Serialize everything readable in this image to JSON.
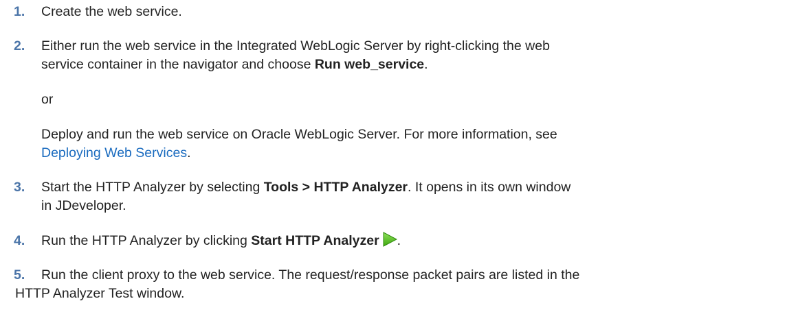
{
  "steps": [
    {
      "number": "1.",
      "text": "Create the web service."
    },
    {
      "number": "2.",
      "line1": "Either run the web service in the Integrated WebLogic Server by right-clicking the web",
      "line2_pre": "service container in the navigator and choose ",
      "line2_bold": "Run web_service",
      "line2_post": "."
    },
    {
      "number": "3.",
      "line1_pre": "Start the HTTP Analyzer by selecting ",
      "line1_bold": "Tools > HTTP Analyzer",
      "line1_post": ". It opens in its own window",
      "line2": "in JDeveloper."
    },
    {
      "number": "4.",
      "pre": "Run the HTTP Analyzer by clicking ",
      "bold": "Start HTTP Analyzer",
      "post": "."
    },
    {
      "number": "5.",
      "line1": "Run the client proxy to the web service. The request/response packet pairs are listed in the",
      "line2": "HTTP Analyzer Test window."
    }
  ],
  "or_text": "or",
  "deploy": {
    "line1": "Deploy and run the web service on Oracle WebLogic Server. For more information, see",
    "link": "Deploying Web Services",
    "after_link": "."
  },
  "icons": {
    "start": "play-icon",
    "start_color": "#5cc21d"
  }
}
